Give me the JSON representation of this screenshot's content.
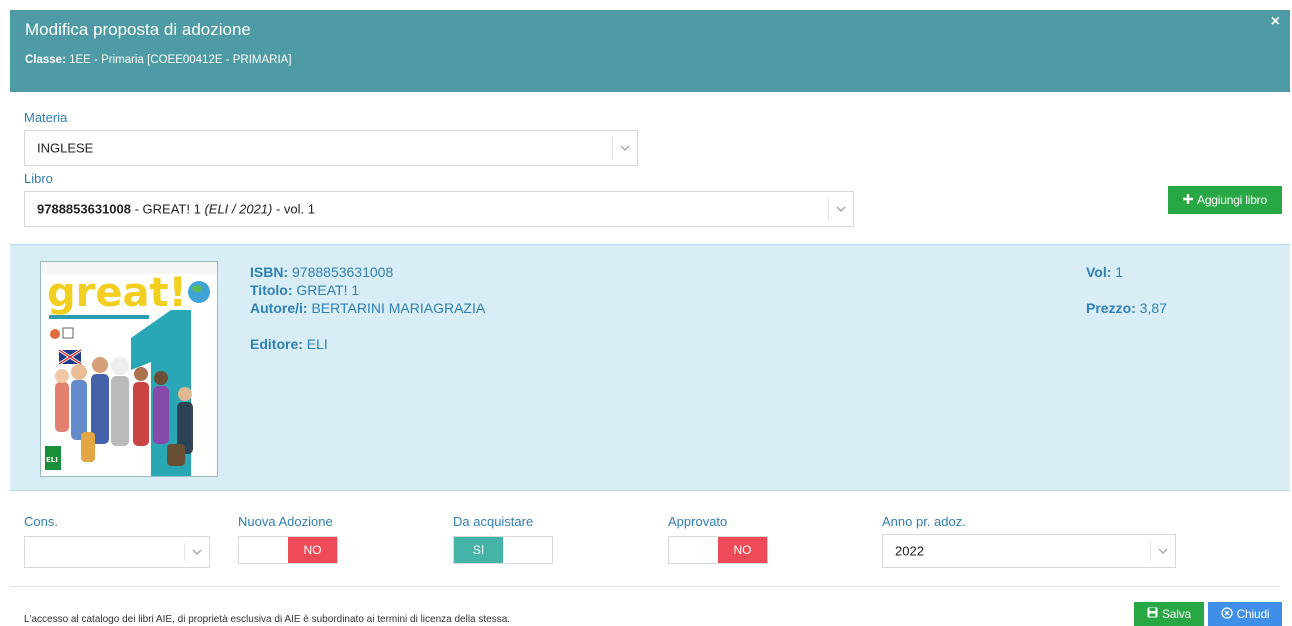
{
  "modal": {
    "title": "Modifica proposta di adozione",
    "classe_label": "Classe:",
    "classe_value": " 1EE - Primaria [COEE00412E - PRIMARIA]",
    "close_glyph": "×"
  },
  "form": {
    "materia_label": "Materia",
    "materia_value": "INGLESE",
    "libro_label": "Libro",
    "libro_isbn": "9788853631008",
    "libro_title": " - GREAT! 1 ",
    "libro_meta": "(ELI / 2021)",
    "libro_vol": " - vol. 1",
    "add_book_label": "Aggiungi libro"
  },
  "book": {
    "isbn_label": "ISBN:",
    "isbn_value": " 9788853631008",
    "titolo_label": "Titolo:",
    "titolo_value": " GREAT! 1",
    "autore_label": "Autore/i:",
    "autore_value": " BERTARINI MARIAGRAZIA",
    "editore_label": "Editore:",
    "editore_value": " ELI",
    "vol_label": "Vol:",
    "vol_value": " 1",
    "prezzo_label": "Prezzo:",
    "prezzo_value": " 3,87",
    "cover_title": "great!",
    "cover_number": "1",
    "cover_publisher": "ELI"
  },
  "options": {
    "cons_label": "Cons.",
    "cons_value": "",
    "nuova_label": "Nuova Adozione",
    "nuova_state": "NO",
    "acquistare_label": "Da acquistare",
    "acquistare_state": "SI",
    "approvato_label": "Approvato",
    "approvato_state": "NO",
    "anno_label": "Anno pr. adoz.",
    "anno_value": "2022"
  },
  "footer": {
    "license_text": "L'accesso al catalogo dei libri AIE, di proprietà esclusiva di AIE è subordinato ai termini di licenza della stessa.",
    "save_label": "Salva",
    "close_label": "Chiudi"
  },
  "colors": {
    "header": "#4e9ba5",
    "label": "#2f7fb8",
    "panel": "#d8edf6",
    "green": "#28a745",
    "blue": "#3f8ee8",
    "no": "#ef4a57",
    "si": "#44b4a8"
  }
}
